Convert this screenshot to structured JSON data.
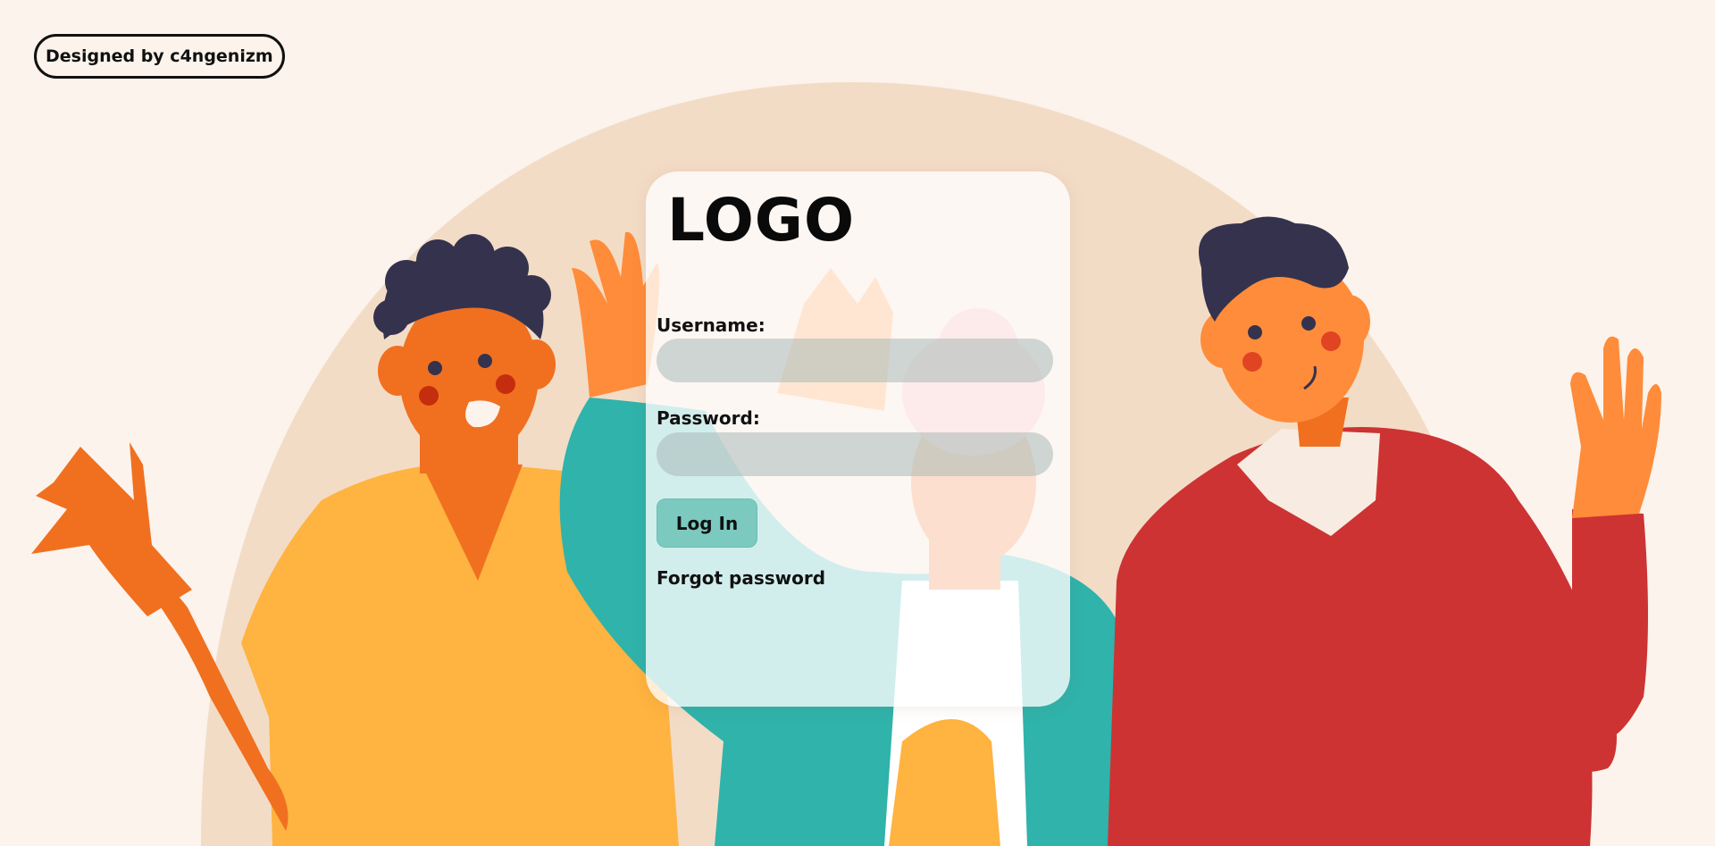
{
  "credit": {
    "text": "Designed by c4ngenizm"
  },
  "login": {
    "logo": "LOGO",
    "username_label": "Username:",
    "username_value": "",
    "password_label": "Password:",
    "password_value": "",
    "submit_label": "Log In",
    "forgot_label": "Forgot password"
  },
  "colors": {
    "background": "#fbf3ec",
    "arch": "#f3dcc6",
    "skin_orange": "#f07020",
    "shirt_yellow": "#ffb340",
    "hoodie_teal": "#2fb3ab",
    "sweater_red": "#cd3333",
    "hair_navy": "#35324e",
    "button": "#7ccabf"
  }
}
